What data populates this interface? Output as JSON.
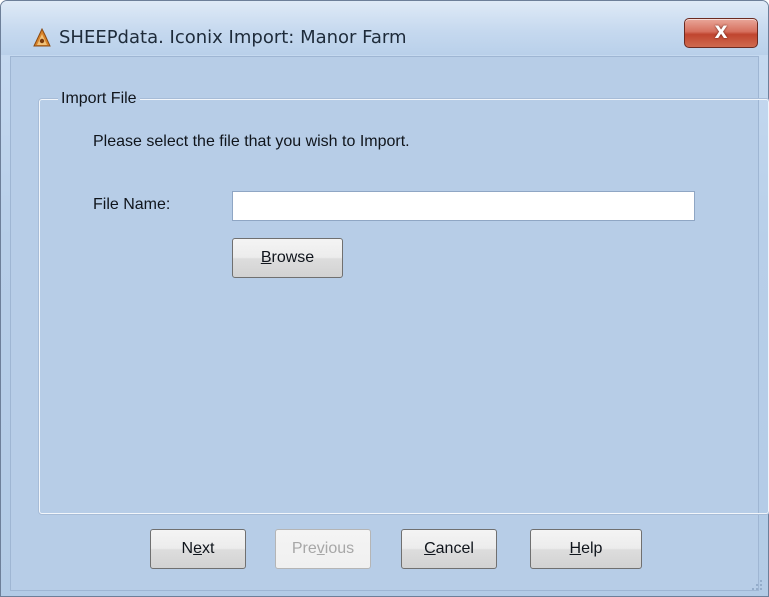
{
  "window": {
    "title": "SHEEPdata. Iconix Import: Manor Farm",
    "close_label": "X",
    "app_icon": "sheep-app-icon"
  },
  "group": {
    "legend": "Import File",
    "instructions": "Please select the file that you wish to Import."
  },
  "file_field": {
    "label": "File Name:",
    "value": ""
  },
  "buttons": {
    "browse": {
      "text": "Browse",
      "accel": "B",
      "rest": "rowse"
    },
    "next": {
      "before": "N",
      "accel": "e",
      "after": "xt"
    },
    "previous": {
      "before": "Pre",
      "accel": "v",
      "after": "ious"
    },
    "cancel": {
      "accel": "C",
      "rest": "ancel"
    },
    "help": {
      "accel": "H",
      "rest": "elp"
    }
  },
  "colors": {
    "dialog_bg": "#b7cde7",
    "close_red": "#c0452f"
  }
}
